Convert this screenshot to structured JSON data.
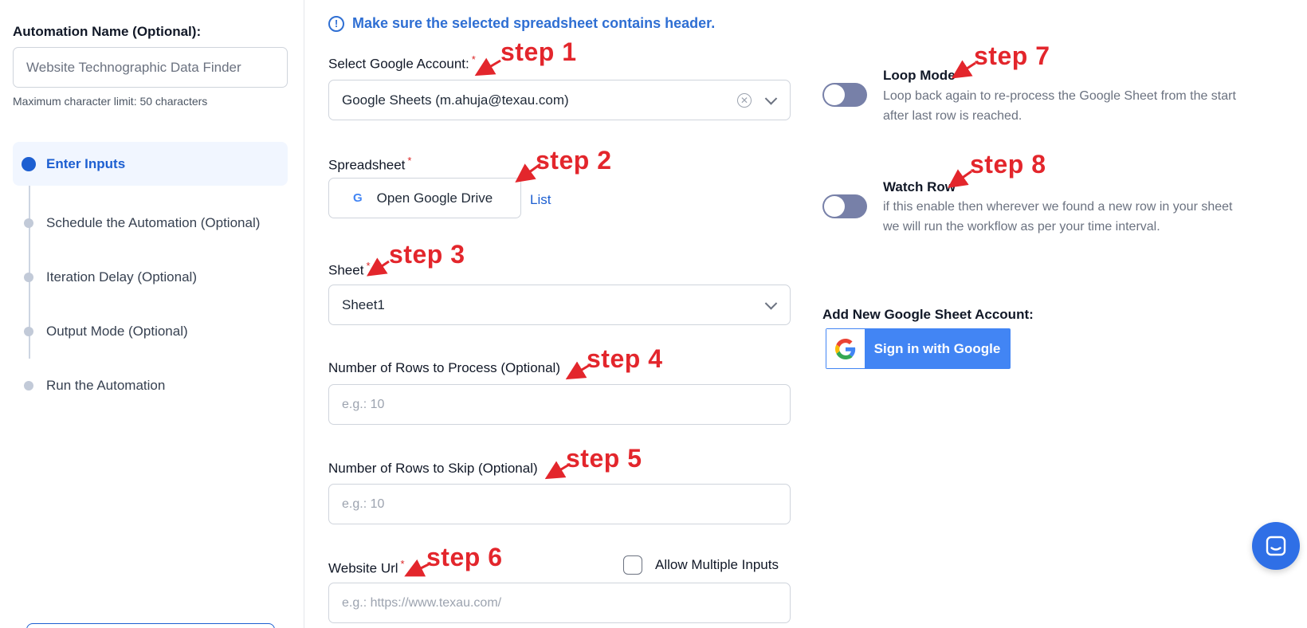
{
  "sidebar": {
    "name_label": "Automation Name (Optional):",
    "name_value": "Website Technographic Data Finder",
    "hint": "Maximum character limit: 50 characters",
    "steps": [
      {
        "label": "Enter Inputs",
        "active": true
      },
      {
        "label": "Schedule the Automation (Optional)",
        "active": false
      },
      {
        "label": "Iteration Delay (Optional)",
        "active": false
      },
      {
        "label": "Output Mode (Optional)",
        "active": false
      },
      {
        "label": "Run the Automation",
        "active": false
      }
    ]
  },
  "notice": {
    "icon": "info-icon",
    "text": "Make sure the selected spreadsheet contains header."
  },
  "form": {
    "required_mark": "*",
    "account": {
      "label": "Select Google Account:",
      "value": "Google Sheets (m.ahuja@texau.com)"
    },
    "spreadsheet": {
      "label": "Spreadsheet",
      "button": "Open Google Drive",
      "link": "List"
    },
    "sheet": {
      "label": "Sheet",
      "value": "Sheet1"
    },
    "rows_process": {
      "label": "Number of Rows to Process (Optional)",
      "placeholder": "e.g.: 10"
    },
    "rows_skip": {
      "label": "Number of Rows to Skip (Optional)",
      "placeholder": "e.g.: 10"
    },
    "website": {
      "label": "Website Url",
      "placeholder": "e.g.: https://www.texau.com/",
      "multi_label": "Allow Multiple Inputs",
      "multi_checked": false
    }
  },
  "options": {
    "loop_mode": {
      "title": "Loop Mode",
      "desc_line1": "Loop back again to re-process the Google Sheet from the start",
      "desc_line2": "after last row is reached.",
      "enabled": false
    },
    "watch_row": {
      "title": "Watch Row",
      "desc_line1": "if this enable then wherever we found a new row in your sheet",
      "desc_line2": "we will run the workflow as per your time interval.",
      "enabled": false
    }
  },
  "google_account": {
    "label": "Add New Google Sheet Account:",
    "button": "Sign in with Google",
    "g_letter": "G"
  },
  "annotations": {
    "step1": "step 1",
    "step2": "step 2",
    "step3": "step 3",
    "step4": "step 4",
    "step5": "step 5",
    "step6": "step 6",
    "step7": "step 7",
    "step8": "step 8"
  },
  "colors": {
    "accent": "#1d5fd1",
    "toggle_off": "#7780a8",
    "annotation_red": "#e3262c",
    "google_blue": "#4285f4"
  }
}
